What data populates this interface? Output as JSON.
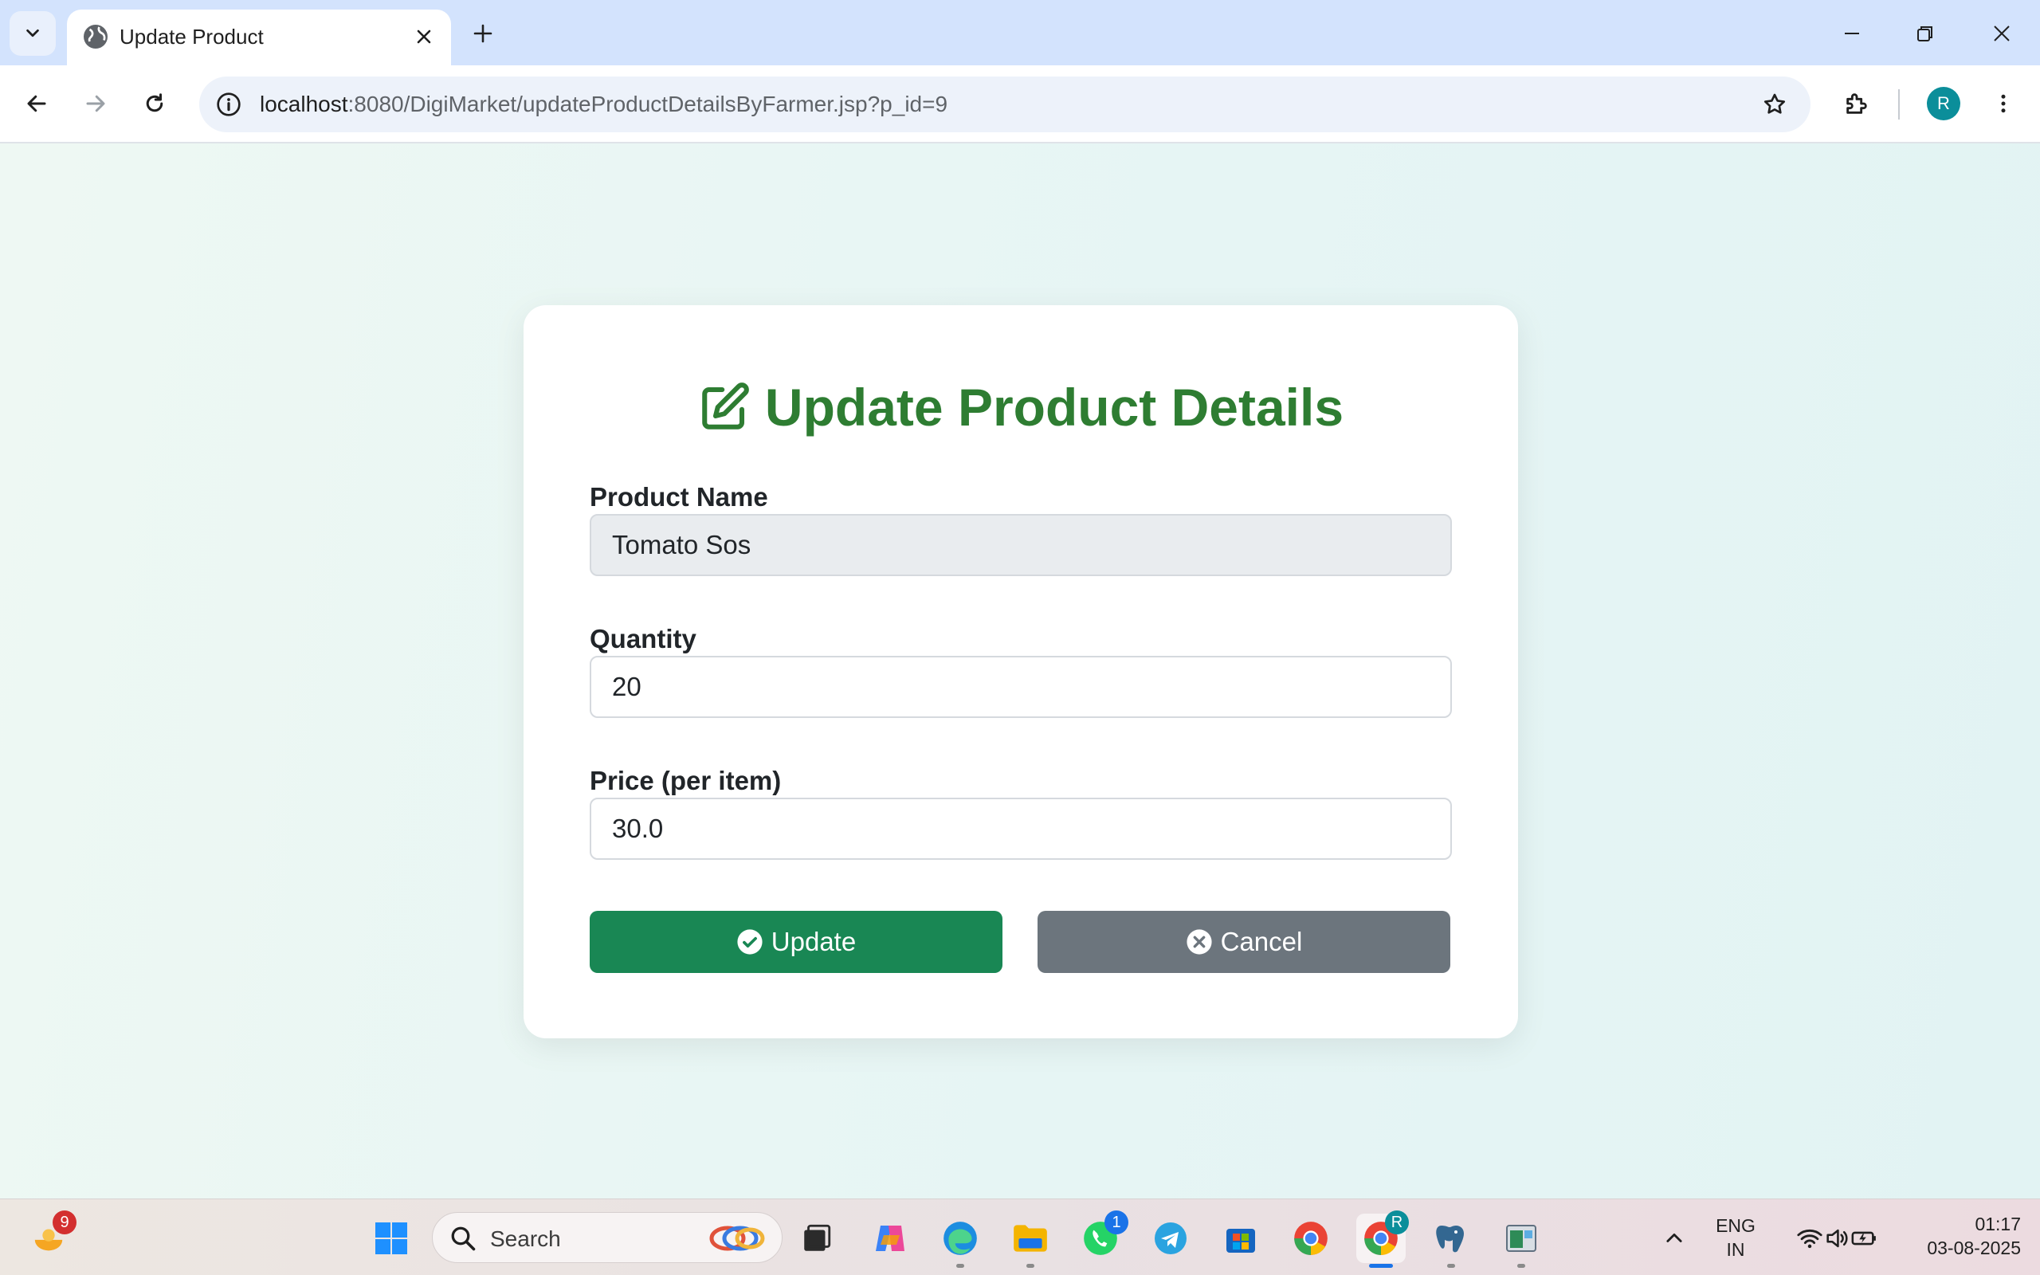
{
  "browser": {
    "tab_title": "Update Product",
    "url_host": "localhost",
    "url_rest": ":8080/DigiMarket/updateProductDetailsByFarmer.jsp?p_id=9",
    "profile_initial": "R"
  },
  "form": {
    "title": "Update Product Details",
    "product_name_label": "Product Name",
    "product_name_value": "Tomato Sos",
    "quantity_label": "Quantity",
    "quantity_value": "20",
    "price_label": "Price (per item)",
    "price_value": "30.0",
    "update_label": "Update",
    "cancel_label": "Cancel"
  },
  "taskbar": {
    "search_placeholder": "Search",
    "weather_badge": "9",
    "whatsapp_badge": "1",
    "chrome_profile_badge": "R",
    "language_line1": "ENG",
    "language_line2": "IN",
    "time": "01:17",
    "date": "03-08-2025"
  },
  "colors": {
    "title_green": "#2e7d32",
    "update_button": "#198754",
    "cancel_button": "#6c757d",
    "readonly_field": "#e9ecef"
  }
}
